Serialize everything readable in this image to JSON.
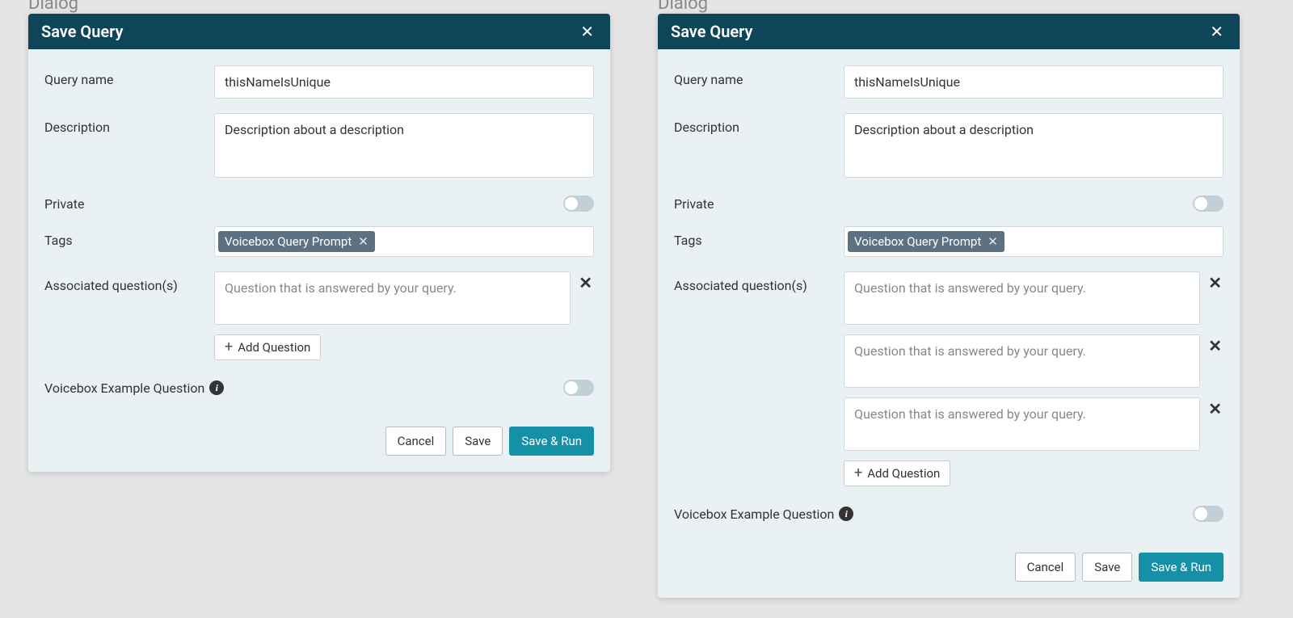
{
  "page_label": "Dialog",
  "dialog1": {
    "title": "Save Query",
    "fields": {
      "query_name_label": "Query name",
      "query_name_value": "thisNameIsUnique",
      "description_label": "Description",
      "description_value": "Description about a description",
      "private_label": "Private",
      "tags_label": "Tags",
      "tag_value": "Voicebox Query Prompt",
      "associated_label": "Associated question(s)",
      "question_placeholder": "Question that is answered by your query.",
      "add_question_label": "Add Question",
      "voicebox_label": "Voicebox Example Question"
    },
    "buttons": {
      "cancel": "Cancel",
      "save": "Save",
      "save_run": "Save & Run"
    }
  },
  "dialog2": {
    "title": "Save Query",
    "fields": {
      "query_name_label": "Query name",
      "query_name_value": "thisNameIsUnique",
      "description_label": "Description",
      "description_value": "Description about a description",
      "private_label": "Private",
      "tags_label": "Tags",
      "tag_value": "Voicebox Query Prompt",
      "associated_label": "Associated question(s)",
      "question_placeholder": "Question that is answered by your query.",
      "add_question_label": "Add Question",
      "voicebox_label": "Voicebox Example Question"
    },
    "buttons": {
      "cancel": "Cancel",
      "save": "Save",
      "save_run": "Save & Run"
    }
  }
}
